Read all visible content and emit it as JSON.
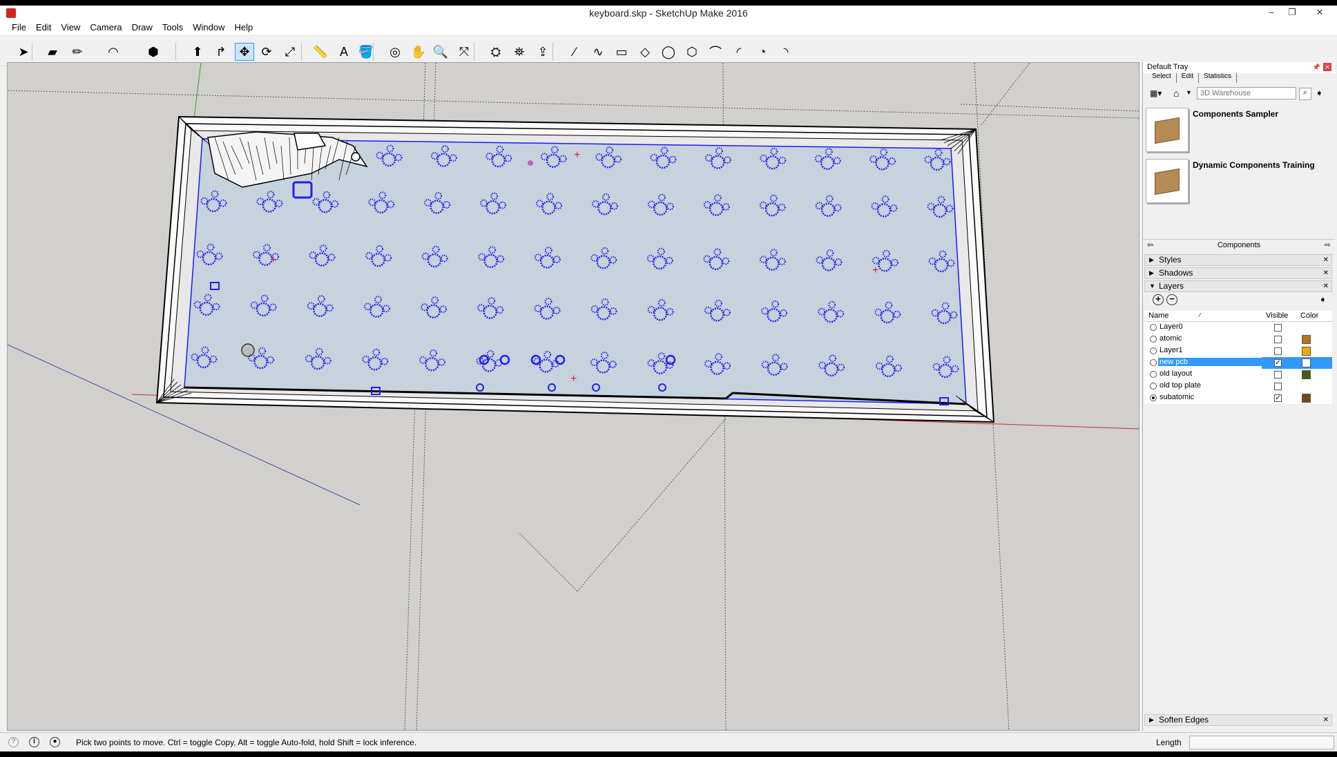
{
  "window": {
    "title": "keyboard.skp - SketchUp Make 2016",
    "minimize": "–",
    "maximize": "❐",
    "close": "✕"
  },
  "menu": [
    "File",
    "Edit",
    "View",
    "Camera",
    "Draw",
    "Tools",
    "Window",
    "Help"
  ],
  "toolbar": {
    "tools": [
      {
        "name": "select-tool-icon",
        "glyph": "➤"
      },
      {
        "name": "eraser-tool-icon",
        "glyph": "▰"
      },
      {
        "name": "line-tool-icon",
        "glyph": "✏"
      },
      {
        "name": "arc-tool-icon",
        "glyph": "◠"
      },
      {
        "name": "shape-tool-icon",
        "glyph": "⬢"
      },
      {
        "name": "push-pull-tool-icon",
        "glyph": "⬆"
      },
      {
        "name": "offset-tool-icon",
        "glyph": "↱"
      },
      {
        "name": "move-tool-icon",
        "glyph": "✥",
        "active": true
      },
      {
        "name": "rotate-tool-icon",
        "glyph": "⟳"
      },
      {
        "name": "scale-tool-icon",
        "glyph": "⤢"
      },
      {
        "name": "tape-measure-tool-icon",
        "glyph": "📏"
      },
      {
        "name": "text-tool-icon",
        "glyph": "A"
      },
      {
        "name": "paint-bucket-tool-icon",
        "glyph": "🪣"
      },
      {
        "name": "orbit-tool-icon",
        "glyph": "◎"
      },
      {
        "name": "pan-tool-icon",
        "glyph": "✋"
      },
      {
        "name": "zoom-tool-icon",
        "glyph": "🔍"
      },
      {
        "name": "zoom-extents-tool-icon",
        "glyph": "⤧"
      },
      {
        "name": "warehouse-icon",
        "glyph": "⛭"
      },
      {
        "name": "extension-warehouse-icon",
        "glyph": "⛯"
      },
      {
        "name": "share-model-icon",
        "glyph": "⇪"
      },
      {
        "name": "freehand-tool-icon",
        "glyph": "∕"
      },
      {
        "name": "freehand-curve-icon",
        "glyph": "∿"
      },
      {
        "name": "rectangle-tool-icon",
        "glyph": "▭"
      },
      {
        "name": "rotated-rectangle-tool-icon",
        "glyph": "◇"
      },
      {
        "name": "circle-tool-icon",
        "glyph": "◯"
      },
      {
        "name": "polygon-tool-icon",
        "glyph": "⬡"
      },
      {
        "name": "arc-2pt-tool-icon",
        "glyph": "⌒"
      },
      {
        "name": "arc-3pt-tool-icon",
        "glyph": "◜"
      },
      {
        "name": "pie-tool-icon",
        "glyph": "◔"
      },
      {
        "name": "arc-center-tool-icon",
        "glyph": "◝"
      }
    ]
  },
  "tray": {
    "title": "Default Tray",
    "tabs": [
      "Select",
      "Edit",
      "Statistics"
    ],
    "search_placeholder": "3D Warehouse",
    "components": [
      {
        "name": "Components Sampler"
      },
      {
        "name": "Dynamic Components Training"
      }
    ],
    "components_label": "Components",
    "panels": {
      "styles": "Styles",
      "shadows": "Shadows",
      "layers": "Layers",
      "soften_edges": "Soften Edges"
    },
    "layers_header": {
      "name": "Name",
      "visible": "Visible",
      "color": "Color"
    },
    "layers": [
      {
        "name": "Layer0",
        "visible": false,
        "active": false,
        "color": null
      },
      {
        "name": "atomic",
        "visible": false,
        "active": false,
        "color": "#b8741a"
      },
      {
        "name": "Layer1",
        "visible": false,
        "active": false,
        "color": "#f2a900"
      },
      {
        "name": "new pcb",
        "visible": true,
        "active": false,
        "color": "#ffffff",
        "selected": true
      },
      {
        "name": "old layout",
        "visible": false,
        "active": false,
        "color": "#4a5a10"
      },
      {
        "name": "old top plate",
        "visible": false,
        "active": false,
        "color": null
      },
      {
        "name": "subatomic",
        "visible": true,
        "active": true,
        "color": "#7a4a10"
      }
    ]
  },
  "status": {
    "text": "Pick two points to move.  Ctrl = toggle Copy, Alt = toggle Auto-fold, hold Shift = lock inference.",
    "length_label": "Length",
    "length_value": ""
  },
  "colors": {
    "viewport_bg": "#d1d0cc",
    "pcb_fill": "#c6d2dc",
    "switch_blue": "#1f1ff0",
    "selection_blue": "#3399ff"
  }
}
